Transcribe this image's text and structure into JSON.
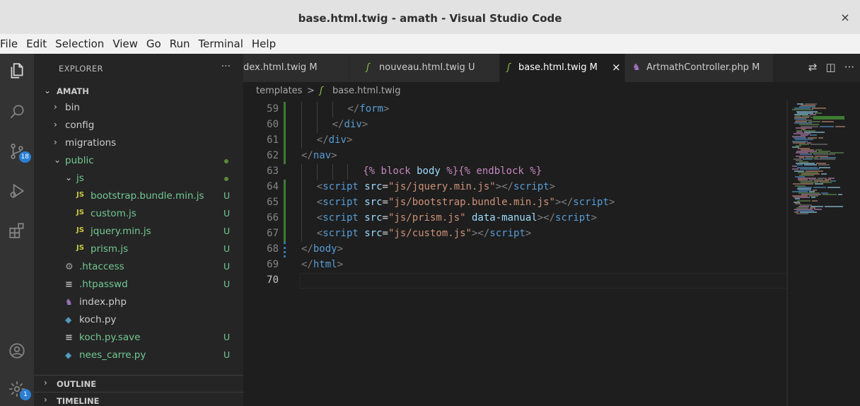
{
  "window": {
    "title": "base.html.twig - amath - Visual Studio Code",
    "close_glyph": "×"
  },
  "menu": [
    "File",
    "Edit",
    "Selection",
    "View",
    "Go",
    "Run",
    "Terminal",
    "Help"
  ],
  "activity": {
    "items": [
      {
        "name": "explorer-icon"
      },
      {
        "name": "search-icon"
      },
      {
        "name": "source-control-icon",
        "badge": "18"
      },
      {
        "name": "run-debug-icon"
      },
      {
        "name": "extensions-icon"
      }
    ],
    "bottom": [
      {
        "name": "account-icon"
      },
      {
        "name": "manage-gear-icon",
        "badge": "1"
      }
    ]
  },
  "sidebar": {
    "header": "EXPLORER",
    "more": "···",
    "root": "AMATH",
    "tree": [
      {
        "label": "bin",
        "type": "folder",
        "open": false,
        "depth": 1,
        "status": "",
        "color": "plain"
      },
      {
        "label": "config",
        "type": "folder",
        "open": false,
        "depth": 1,
        "status": "",
        "color": "plain"
      },
      {
        "label": "migrations",
        "type": "folder",
        "open": false,
        "depth": 1,
        "status": "",
        "color": "plain"
      },
      {
        "label": "public",
        "type": "folder",
        "open": true,
        "depth": 1,
        "status": "dot",
        "color": "green"
      },
      {
        "label": "js",
        "type": "folder",
        "open": true,
        "depth": 2,
        "status": "dot",
        "color": "green"
      },
      {
        "label": "bootstrap.bundle.min.js",
        "type": "js",
        "depth": 3,
        "status": "U",
        "color": "green"
      },
      {
        "label": "custom.js",
        "type": "js",
        "depth": 3,
        "status": "U",
        "color": "green"
      },
      {
        "label": "jquery.min.js",
        "type": "js",
        "depth": 3,
        "status": "U",
        "color": "green"
      },
      {
        "label": "prism.js",
        "type": "js",
        "depth": 3,
        "status": "U",
        "color": "green"
      },
      {
        "label": ".htaccess",
        "type": "gear",
        "depth": 2,
        "status": "U",
        "color": "green"
      },
      {
        "label": ".htpasswd",
        "type": "lines",
        "depth": 2,
        "status": "U",
        "color": "green"
      },
      {
        "label": "index.php",
        "type": "php",
        "depth": 2,
        "status": "",
        "color": "plain"
      },
      {
        "label": "koch.py",
        "type": "py",
        "depth": 2,
        "status": "",
        "color": "plain"
      },
      {
        "label": "koch.py.save",
        "type": "lines",
        "depth": 2,
        "status": "U",
        "color": "green"
      },
      {
        "label": "nees_carre.py",
        "type": "py",
        "depth": 2,
        "status": "U",
        "color": "green"
      }
    ],
    "sections": [
      "OUTLINE",
      "TIMELINE"
    ]
  },
  "tabs": [
    {
      "label": "dex.html.twig",
      "status": "M",
      "icon": "none",
      "active": false
    },
    {
      "label": "nouveau.html.twig",
      "status": "U",
      "icon": "twig",
      "active": false
    },
    {
      "label": "base.html.twig",
      "status": "M",
      "icon": "twig",
      "active": true
    },
    {
      "label": "ArtmathController.php",
      "status": "M",
      "icon": "php",
      "active": false
    }
  ],
  "tab_actions": [
    "split-compare",
    "split-editor",
    "more"
  ],
  "breadcrumb": [
    "templates",
    ">",
    "base.html.twig"
  ],
  "editor": {
    "current_line": 70,
    "lines": [
      {
        "n": 59,
        "gutter": "mod",
        "indent": 3,
        "tokens": [
          [
            "punc",
            "</"
          ],
          [
            "tag",
            "form"
          ],
          [
            "punc",
            ">"
          ]
        ]
      },
      {
        "n": 60,
        "gutter": "mod",
        "indent": 2,
        "tokens": [
          [
            "punc",
            "</"
          ],
          [
            "tag",
            "div"
          ],
          [
            "punc",
            ">"
          ]
        ]
      },
      {
        "n": 61,
        "gutter": "mod",
        "indent": 1,
        "tokens": [
          [
            "punc",
            "</"
          ],
          [
            "tag",
            "div"
          ],
          [
            "punc",
            ">"
          ]
        ]
      },
      {
        "n": 62,
        "gutter": "mod",
        "indent": 0,
        "tokens": [
          [
            "punc",
            "</"
          ],
          [
            "tag",
            "nav"
          ],
          [
            "punc",
            ">"
          ]
        ]
      },
      {
        "n": 63,
        "gutter": "none",
        "indent": 4,
        "tokens": [
          [
            "twig",
            "{%"
          ],
          [
            "plain",
            " "
          ],
          [
            "twig",
            "block"
          ],
          [
            "plain",
            " "
          ],
          [
            "attr",
            "body"
          ],
          [
            "plain",
            " "
          ],
          [
            "twig",
            "%}{%"
          ],
          [
            "plain",
            " "
          ],
          [
            "twig",
            "endblock"
          ],
          [
            "plain",
            " "
          ],
          [
            "twig",
            "%}"
          ]
        ]
      },
      {
        "n": 64,
        "gutter": "mod",
        "indent": 1,
        "tokens": [
          [
            "punc",
            "<"
          ],
          [
            "tag",
            "script"
          ],
          [
            "plain",
            " "
          ],
          [
            "attr",
            "src"
          ],
          [
            "plain",
            "="
          ],
          [
            "str",
            "\"js/jquery.min.js\""
          ],
          [
            "punc",
            "></"
          ],
          [
            "tag",
            "script"
          ],
          [
            "punc",
            ">"
          ]
        ]
      },
      {
        "n": 65,
        "gutter": "mod",
        "indent": 1,
        "tokens": [
          [
            "punc",
            "<"
          ],
          [
            "tag",
            "script"
          ],
          [
            "plain",
            " "
          ],
          [
            "attr",
            "src"
          ],
          [
            "plain",
            "="
          ],
          [
            "str",
            "\"js/bootstrap.bundle.min.js\""
          ],
          [
            "punc",
            "></"
          ],
          [
            "tag",
            "script"
          ],
          [
            "punc",
            ">"
          ]
        ]
      },
      {
        "n": 66,
        "gutter": "mod",
        "indent": 1,
        "tokens": [
          [
            "punc",
            "<"
          ],
          [
            "tag",
            "script"
          ],
          [
            "plain",
            " "
          ],
          [
            "attr",
            "src"
          ],
          [
            "plain",
            "="
          ],
          [
            "str",
            "\"js/prism.js\""
          ],
          [
            "plain",
            " "
          ],
          [
            "attr",
            "data-manual"
          ],
          [
            "punc",
            "></"
          ],
          [
            "tag",
            "script"
          ],
          [
            "punc",
            ">"
          ]
        ]
      },
      {
        "n": 67,
        "gutter": "mod",
        "indent": 1,
        "tokens": [
          [
            "punc",
            "<"
          ],
          [
            "tag",
            "script"
          ],
          [
            "plain",
            " "
          ],
          [
            "attr",
            "src"
          ],
          [
            "plain",
            "="
          ],
          [
            "str",
            "\"js/custom.js\""
          ],
          [
            "punc",
            "></"
          ],
          [
            "tag",
            "script"
          ],
          [
            "punc",
            ">"
          ]
        ]
      },
      {
        "n": 68,
        "gutter": "del",
        "indent": 0,
        "tokens": [
          [
            "punc",
            "</"
          ],
          [
            "tag",
            "body"
          ],
          [
            "punc",
            ">"
          ]
        ]
      },
      {
        "n": 69,
        "gutter": "none",
        "indent": 0,
        "tokens": [
          [
            "punc",
            "</"
          ],
          [
            "tag",
            "html"
          ],
          [
            "punc",
            ">"
          ]
        ]
      },
      {
        "n": 70,
        "gutter": "none",
        "indent": 0,
        "tokens": []
      }
    ]
  },
  "colors": {
    "punc": "#808080",
    "tag": "#569cd6",
    "attr": "#9cdcfe",
    "str": "#ce9178",
    "twig": "#c586c0",
    "plain": "#d4d4d4",
    "git_untracked": "#73c991",
    "badge": "#2a7fd4"
  }
}
